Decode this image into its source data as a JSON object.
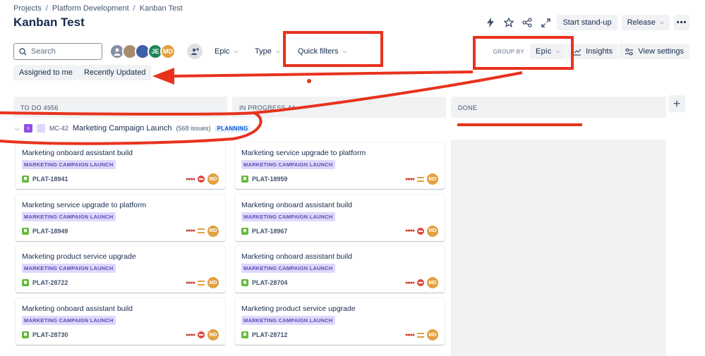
{
  "breadcrumb": {
    "items": [
      "Projects",
      "Platform Development",
      "Kanban Test"
    ],
    "separator": "/"
  },
  "page_title": "Kanban Test",
  "header_actions": {
    "standup": "Start stand-up",
    "release": "Release",
    "more": "•••"
  },
  "search": {
    "placeholder": "Search"
  },
  "avatars": [
    {
      "initials": "",
      "kind": "default"
    },
    {
      "initials": "",
      "kind": "photo"
    },
    {
      "initials": "",
      "kind": "photo"
    },
    {
      "initials": "JE",
      "kind": "initials"
    },
    {
      "initials": "MD",
      "kind": "initials"
    }
  ],
  "filters": {
    "epic": "Epic",
    "type": "Type",
    "quick_filters": "Quick filters"
  },
  "group_by": {
    "label": "GROUP BY",
    "value": "Epic"
  },
  "insights": "Insights",
  "view_settings": "View settings",
  "quick_pills": [
    "Assigned to me",
    "Recently Updated"
  ],
  "columns": [
    {
      "title": "TO DO 4956"
    },
    {
      "title": "IN PROGRESS 44"
    },
    {
      "title": "DONE"
    }
  ],
  "swimlane": {
    "key": "MC-42",
    "name": "Marketing Campaign Launch",
    "count": "(568 issues)",
    "status": "PLANNING"
  },
  "cards_todo": [
    {
      "title": "Marketing onboard assistant build",
      "epic": "MARKETING CAMPAIGN LAUNCH",
      "key": "PLAT-18941",
      "priority": "blocker",
      "assignee": "MD"
    },
    {
      "title": "Marketing service upgrade to platform",
      "epic": "MARKETING CAMPAIGN LAUNCH",
      "key": "PLAT-18949",
      "priority": "medium",
      "assignee": "MD"
    },
    {
      "title": "Marketing product service upgrade",
      "epic": "MARKETING CAMPAIGN LAUNCH",
      "key": "PLAT-28722",
      "priority": "medium",
      "assignee": "MD"
    },
    {
      "title": "Marketing onboard assistant build",
      "epic": "MARKETING CAMPAIGN LAUNCH",
      "key": "PLAT-28730",
      "priority": "blocker",
      "assignee": "MD"
    }
  ],
  "cards_inprogress": [
    {
      "title": "Marketing service upgrade to platform",
      "epic": "MARKETING CAMPAIGN LAUNCH",
      "key": "PLAT-18959",
      "priority": "medium",
      "assignee": "MD"
    },
    {
      "title": "Marketing onboard assistant build",
      "epic": "MARKETING CAMPAIGN LAUNCH",
      "key": "PLAT-18967",
      "priority": "blocker",
      "assignee": "MD"
    },
    {
      "title": "Marketing onboard assistant build",
      "epic": "MARKETING CAMPAIGN LAUNCH",
      "key": "PLAT-28704",
      "priority": "blocker",
      "assignee": "MD"
    },
    {
      "title": "Marketing product service upgrade",
      "epic": "MARKETING CAMPAIGN LAUNCH",
      "key": "PLAT-28712",
      "priority": "medium",
      "assignee": "MD"
    }
  ],
  "colors": {
    "annotation": "#e8321e",
    "epic_purple": "#904ee2",
    "lozenge_bg": "#dfd8fd"
  }
}
